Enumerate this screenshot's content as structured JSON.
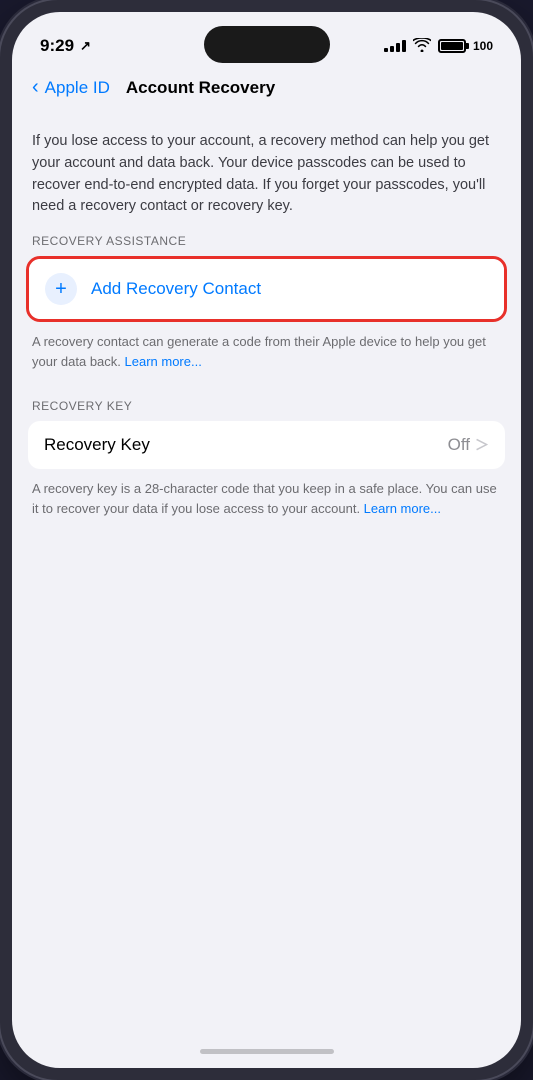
{
  "status_bar": {
    "time": "9:29",
    "battery_percent": "100"
  },
  "navigation": {
    "back_label": "Apple ID",
    "title": "Account Recovery"
  },
  "description": {
    "text": "If you lose access to your account, a recovery method can help you get your account and data back. Your device passcodes can be used to recover end-to-end encrypted data. If you forget your passcodes, you'll need a recovery contact or recovery key."
  },
  "recovery_assistance": {
    "section_label": "RECOVERY ASSISTANCE",
    "add_button_label": "Add Recovery Contact",
    "add_icon": "+",
    "footer_text": "A recovery contact can generate a code from their Apple device to help you get your data back. ",
    "learn_more_label": "Learn more..."
  },
  "recovery_key": {
    "section_label": "RECOVERY KEY",
    "item_label": "Recovery Key",
    "item_value": "Off",
    "footer_text": "A recovery key is a 28-character code that you keep in a safe place. You can use it to recover your data if you lose access to your account. ",
    "learn_more_label": "Learn more..."
  }
}
